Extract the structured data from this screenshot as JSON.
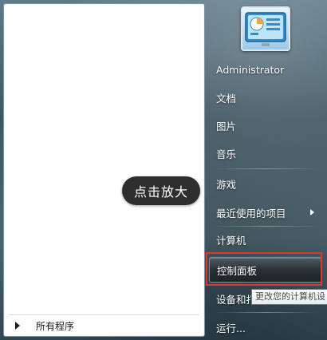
{
  "left_panel": {
    "all_programs_label": "所有程序"
  },
  "right_panel": {
    "items": [
      {
        "label": "Administrator"
      },
      {
        "label": "文档"
      },
      {
        "label": "图片"
      },
      {
        "label": "音乐"
      },
      {
        "label": "游戏"
      },
      {
        "label": "最近使用的项目"
      },
      {
        "label": "计算机"
      },
      {
        "label": "控制面板"
      },
      {
        "label": "设备和打"
      },
      {
        "label": "运行..."
      }
    ]
  },
  "tooltip": {
    "text": "更改您的计算机设"
  },
  "overlay": {
    "zoom_bubble": "点击放大"
  },
  "colors": {
    "highlight_box": "#e0342e",
    "bubble_bg": "#2e2e2e"
  },
  "icons": {
    "user_picture": "control-panel-monitor-icon",
    "all_programs_arrow": "triangle-right-icon",
    "submenu_arrow": "triangle-right-icon"
  }
}
